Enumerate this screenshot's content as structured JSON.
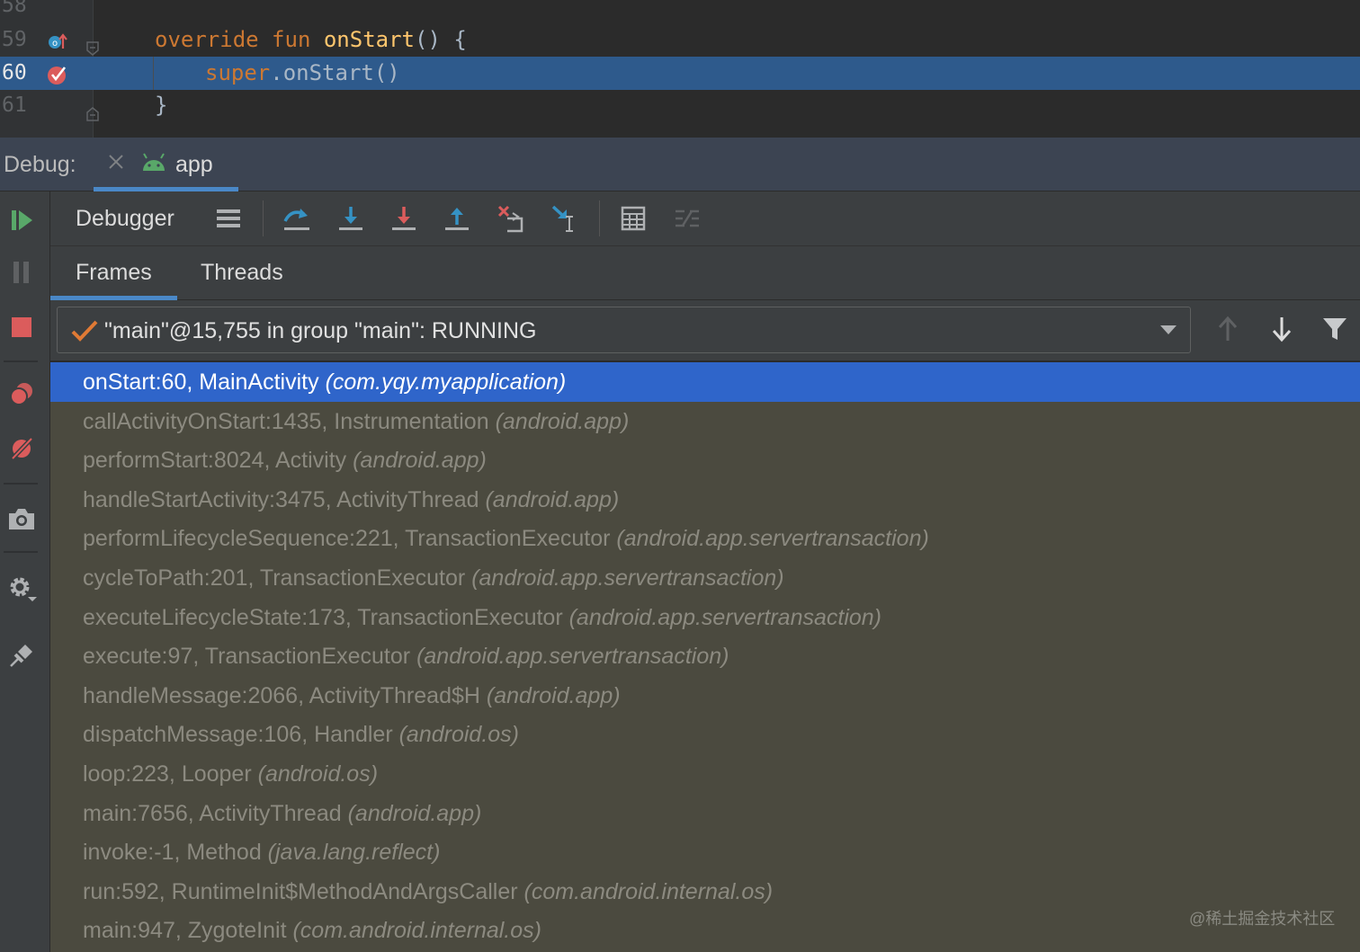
{
  "editor": {
    "lines": [
      {
        "num": "58"
      },
      {
        "num": "59",
        "code": {
          "kw": "override fun ",
          "fn": "onStart",
          "rest": "() {"
        }
      },
      {
        "num": "60",
        "code": {
          "kw": "super",
          "rest": ".onStart()"
        }
      },
      {
        "num": "61",
        "code": {
          "rest": "}"
        }
      }
    ]
  },
  "debug_panel": {
    "label": "Debug:",
    "tab": "app"
  },
  "toolbar": {
    "label": "Debugger",
    "buttons": [
      "layout-icon",
      "step-over-icon",
      "step-into-icon",
      "force-step-into-icon",
      "step-out-icon",
      "drop-frame-icon",
      "run-to-cursor-icon",
      "evaluate-expression-icon",
      "trace-stream-icon"
    ]
  },
  "subtabs": {
    "frames": "Frames",
    "threads": "Threads"
  },
  "thread_selector": {
    "value": "\"main\"@15,755 in group \"main\": RUNNING"
  },
  "frames": [
    {
      "method": "onStart:60, MainActivity",
      "pkg": "(com.yqy.myapplication)",
      "selected": true
    },
    {
      "method": "callActivityOnStart:1435, Instrumentation",
      "pkg": "(android.app)"
    },
    {
      "method": "performStart:8024, Activity",
      "pkg": "(android.app)"
    },
    {
      "method": "handleStartActivity:3475, ActivityThread",
      "pkg": "(android.app)"
    },
    {
      "method": "performLifecycleSequence:221, TransactionExecutor",
      "pkg": "(android.app.servertransaction)"
    },
    {
      "method": "cycleToPath:201, TransactionExecutor",
      "pkg": "(android.app.servertransaction)"
    },
    {
      "method": "executeLifecycleState:173, TransactionExecutor",
      "pkg": "(android.app.servertransaction)"
    },
    {
      "method": "execute:97, TransactionExecutor",
      "pkg": "(android.app.servertransaction)"
    },
    {
      "method": "handleMessage:2066, ActivityThread$H",
      "pkg": "(android.app)"
    },
    {
      "method": "dispatchMessage:106, Handler",
      "pkg": "(android.os)"
    },
    {
      "method": "loop:223, Looper",
      "pkg": "(android.os)"
    },
    {
      "method": "main:7656, ActivityThread",
      "pkg": "(android.app)"
    },
    {
      "method": "invoke:-1, Method",
      "pkg": "(java.lang.reflect)"
    },
    {
      "method": "run:592, RuntimeInit$MethodAndArgsCaller",
      "pkg": "(com.android.internal.os)"
    },
    {
      "method": "main:947, ZygoteInit",
      "pkg": "(com.android.internal.os)"
    }
  ],
  "watermark": "@稀土掘金技术社区",
  "colors": {
    "accent": "#4a88c7",
    "selection": "#2f65ca",
    "breakpoint": "#db5c5c",
    "resume": "#59a869"
  }
}
